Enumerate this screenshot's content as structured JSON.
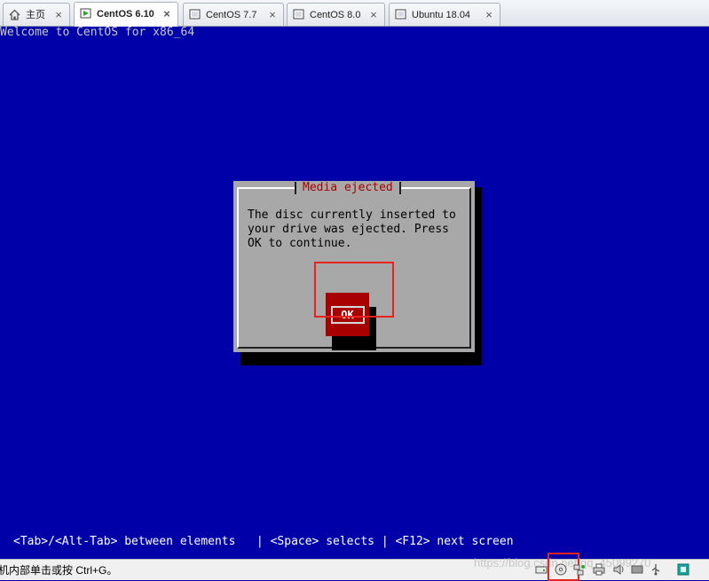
{
  "tabs": [
    {
      "label": "主页",
      "icon": "home-icon",
      "active": false
    },
    {
      "label": "CentOS 6.10",
      "icon": "vm-running-icon",
      "active": true
    },
    {
      "label": "CentOS 7.7",
      "icon": "vm-icon",
      "active": false
    },
    {
      "label": "CentOS 8.0",
      "icon": "vm-icon",
      "active": false
    },
    {
      "label": "Ubuntu 18.04",
      "icon": "vm-icon",
      "active": false
    }
  ],
  "tab_close_glyph": "×",
  "console": {
    "welcome": "Welcome to CentOS for x86_64",
    "dialog": {
      "title": "Media ejected",
      "message": "The disc currently inserted to\nyour drive was ejected. Press\nOK to continue.",
      "ok_label": "OK"
    },
    "hint": "<Tab>/<Alt-Tab> between elements   | <Space> selects | <F12> next screen"
  },
  "statusbar": {
    "text": "机内部单击或按 Ctrl+G。",
    "watermark": "https://blog.csdn.net/qq_45099270",
    "device_icons": [
      "hard-disk-icon",
      "cd-dvd-icon",
      "network-icon",
      "printer-icon",
      "sound-icon",
      "display-icon",
      "usb-icon",
      "vmware-tools-icon"
    ]
  },
  "colors": {
    "console_background": "#0000a8",
    "dialog_background": "#a8a8a8",
    "accent_red": "#a80000",
    "highlight_box": "#e8231f"
  }
}
